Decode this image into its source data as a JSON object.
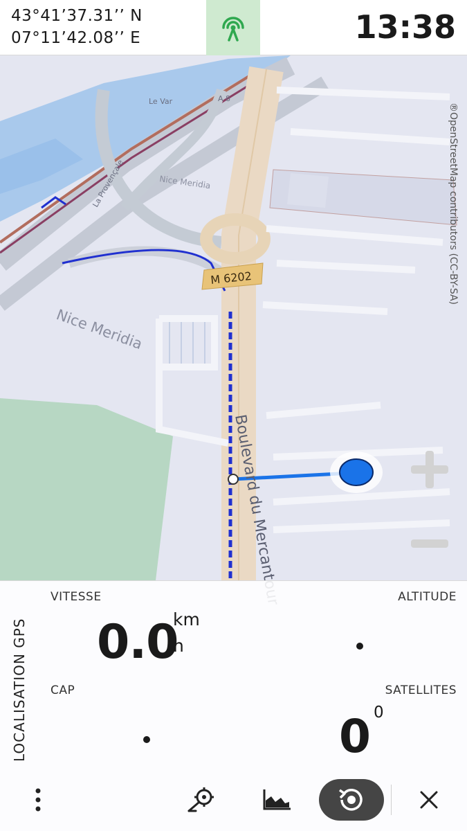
{
  "status": {
    "latitude": "43°41’37.31’’ N",
    "longitude": "07°11’42.08’’ E",
    "time": "13:38"
  },
  "map": {
    "attribution": "®OpenStreetMap contributors (CC-BY-SA)",
    "labels": {
      "district": "Nice Meridia",
      "district_small": "Nice Meridia",
      "street": "Boulevard du Mercantour",
      "road_badge": "M 6202",
      "motorway": "A 8",
      "la_provencale": "La Provençale",
      "le_var": "Le Var"
    }
  },
  "panel": {
    "title": "LOCALISATION GPS",
    "speed_label": "VITESSE",
    "speed_value": "0.0",
    "speed_unit_top": "km",
    "speed_unit_bottom": "h",
    "altitude_label": "ALTITUDE",
    "heading_label": "CAP",
    "satellites_label": "SATELLITES",
    "satellites_value": "0",
    "satellites_super": "0"
  },
  "colors": {
    "accent_green": "#2fa84f",
    "gps_tab_bg": "#cfead0",
    "position_blue": "#1a73e8",
    "track_blue": "#1030c8"
  },
  "icons": {
    "gps_signal": "gps-signal-icon",
    "zoom_in": "plus-icon",
    "zoom_out": "minus-icon",
    "menu": "more-vertical-icon",
    "locate": "locate-target-icon",
    "chart": "elevation-chart-icon",
    "replay": "history-replay-icon",
    "close": "close-icon"
  }
}
